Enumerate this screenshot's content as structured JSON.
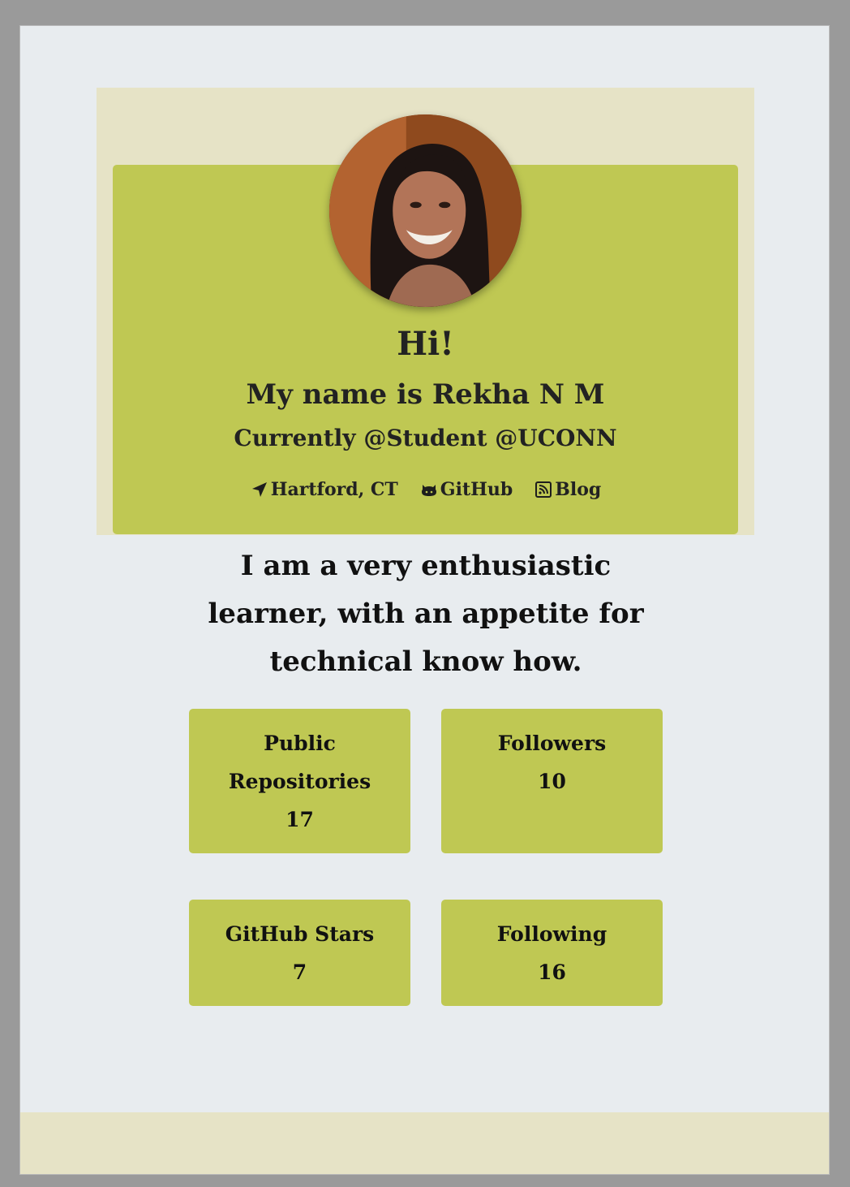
{
  "profile": {
    "greeting": "Hi!",
    "name_line": "My name is Rekha N M",
    "current_line": "Currently @Student @UCONN",
    "avatar_alt": "Profile photo"
  },
  "links": {
    "location": "Hartford, CT",
    "github": "GitHub",
    "blog": "Blog"
  },
  "bio": "I am a very enthusiastic learner, with an appetite for technical know how.",
  "stats": {
    "repos": {
      "label": "Public Repositories",
      "value": "17"
    },
    "followers": {
      "label": "Followers",
      "value": "10"
    },
    "stars": {
      "label": "GitHub Stars",
      "value": "7"
    },
    "following": {
      "label": "Following",
      "value": "16"
    }
  },
  "colors": {
    "card": "#bfc853",
    "band": "#e6e3c6",
    "page": "#e8ecef"
  },
  "icons": {
    "location": "location-arrow-icon",
    "github": "github-icon",
    "blog": "rss-icon"
  }
}
